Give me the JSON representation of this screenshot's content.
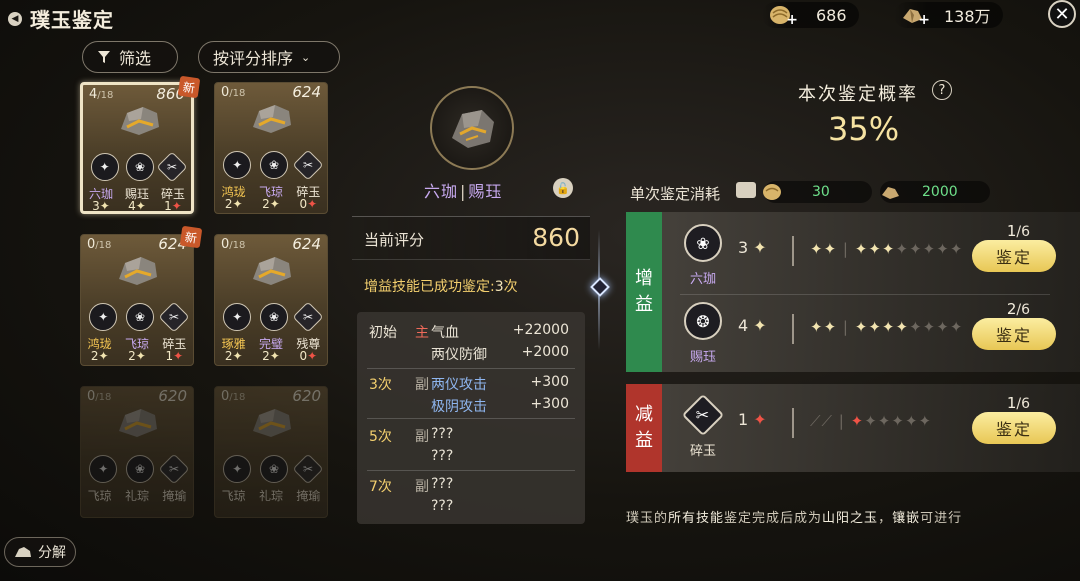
{
  "header": {
    "title": "璞玉鉴定",
    "resource1": {
      "value": "686",
      "icon": "gold-shell-icon"
    },
    "resource2": {
      "value": "138万",
      "icon": "ore-icon"
    }
  },
  "toolbar": {
    "filter_label": "筛选",
    "sort_label": "按评分排序"
  },
  "grid": {
    "cards": [
      {
        "progress": "4",
        "total": "/18",
        "score": "860",
        "is_new": true,
        "new_label": "新",
        "selected": true,
        "faded": false,
        "skills": [
          {
            "name": "六珈",
            "value": "3",
            "neg": false,
            "color": "purple"
          },
          {
            "name": "赐珏",
            "value": "4",
            "neg": false,
            "color": "white"
          },
          {
            "name": "碎玉",
            "value": "1",
            "neg": true,
            "color": "white"
          }
        ]
      },
      {
        "progress": "0",
        "total": "/18",
        "score": "624",
        "is_new": false,
        "selected": false,
        "faded": false,
        "skills": [
          {
            "name": "鸿珑",
            "value": "2",
            "neg": false,
            "color": "gold"
          },
          {
            "name": "飞琼",
            "value": "2",
            "neg": false,
            "color": "purple"
          },
          {
            "name": "碎玉",
            "value": "0",
            "neg": true,
            "color": "white"
          }
        ]
      },
      {
        "progress": "0",
        "total": "/18",
        "score": "624",
        "is_new": true,
        "new_label": "新",
        "selected": false,
        "faded": false,
        "skills": [
          {
            "name": "鸿珑",
            "value": "2",
            "neg": false,
            "color": "gold"
          },
          {
            "name": "飞琼",
            "value": "2",
            "neg": false,
            "color": "purple"
          },
          {
            "name": "碎玉",
            "value": "1",
            "neg": true,
            "color": "white"
          }
        ]
      },
      {
        "progress": "0",
        "total": "/18",
        "score": "624",
        "is_new": false,
        "selected": false,
        "faded": false,
        "skills": [
          {
            "name": "琢雅",
            "value": "2",
            "neg": false,
            "color": "gold"
          },
          {
            "name": "完璧",
            "value": "2",
            "neg": false,
            "color": "purple"
          },
          {
            "name": "残尊",
            "value": "0",
            "neg": true,
            "color": "white"
          }
        ]
      },
      {
        "progress": "0",
        "total": "/18",
        "score": "620",
        "is_new": false,
        "selected": false,
        "faded": true,
        "skills": [
          {
            "name": "飞琼",
            "value": "",
            "neg": false,
            "color": "white"
          },
          {
            "name": "礼琮",
            "value": "",
            "neg": false,
            "color": "white"
          },
          {
            "name": "掩瑜",
            "value": "",
            "neg": true,
            "color": "white"
          }
        ]
      },
      {
        "progress": "0",
        "total": "/18",
        "score": "620",
        "is_new": false,
        "selected": false,
        "faded": true,
        "skills": [
          {
            "name": "飞琼",
            "value": "",
            "neg": false,
            "color": "white"
          },
          {
            "name": "礼琮",
            "value": "",
            "neg": false,
            "color": "white"
          },
          {
            "name": "掩瑜",
            "value": "",
            "neg": true,
            "color": "white"
          }
        ]
      }
    ]
  },
  "decompose_label": "分解",
  "detail": {
    "name_part1": "六珈",
    "sep": "|",
    "name_part2": "赐珏",
    "score_label": "当前评分",
    "score_value": "860",
    "success_text": "增益技能已成功鉴定:",
    "success_count": "3",
    "success_unit": "次",
    "attributes": [
      {
        "level": "初始",
        "tag": "主",
        "tag_type": "main",
        "name": "气血",
        "amount": "+22000"
      },
      {
        "level": "",
        "tag": "",
        "tag_type": "",
        "name": "两仪防御",
        "amount": "+2000"
      },
      {
        "level": "3次",
        "tag": "副",
        "tag_type": "sub",
        "name": "两仪攻击",
        "amount": "+300"
      },
      {
        "level": "",
        "tag": "",
        "tag_type": "",
        "name": "极阴攻击",
        "amount": "+300"
      },
      {
        "level": "5次",
        "tag": "副",
        "tag_type": "sub",
        "name": "???",
        "amount": ""
      },
      {
        "level": "",
        "tag": "",
        "tag_type": "",
        "name": "???",
        "amount": ""
      },
      {
        "level": "7次",
        "tag": "副",
        "tag_type": "sub",
        "name": "???",
        "amount": ""
      },
      {
        "level": "",
        "tag": "",
        "tag_type": "",
        "name": "???",
        "amount": ""
      }
    ]
  },
  "probability": {
    "label": "本次鉴定概率",
    "help": "?",
    "value": "35%"
  },
  "cost": {
    "label": "单次鉴定消耗",
    "item1": "30",
    "item2": "2000"
  },
  "buff_group": {
    "side_label": [
      "增",
      "益"
    ],
    "rows": [
      {
        "name": "六珈",
        "count": "3",
        "stars_filled": 3,
        "stars_total": 8,
        "progress": "1",
        "progress_total": "/6",
        "button": "鉴定"
      },
      {
        "name": "赐珏",
        "count": "4",
        "stars_filled": 4,
        "stars_total": 8,
        "progress": "2",
        "progress_total": "/6",
        "button": "鉴定"
      }
    ]
  },
  "debuff_group": {
    "side_label": [
      "减",
      "益"
    ],
    "rows": [
      {
        "name": "碎玉",
        "count": "1",
        "stars_filled": 1,
        "stars_total": 6,
        "progress": "1",
        "progress_total": "/6",
        "button": "鉴定"
      }
    ]
  },
  "footer": {
    "prefix": "璞玉的",
    "hl1": "所有技能",
    "mid": "鉴定完成后成为",
    "hl2": "山阳之玉",
    "sep": "，",
    "hl3": "镶嵌",
    "suffix": "可进行"
  }
}
